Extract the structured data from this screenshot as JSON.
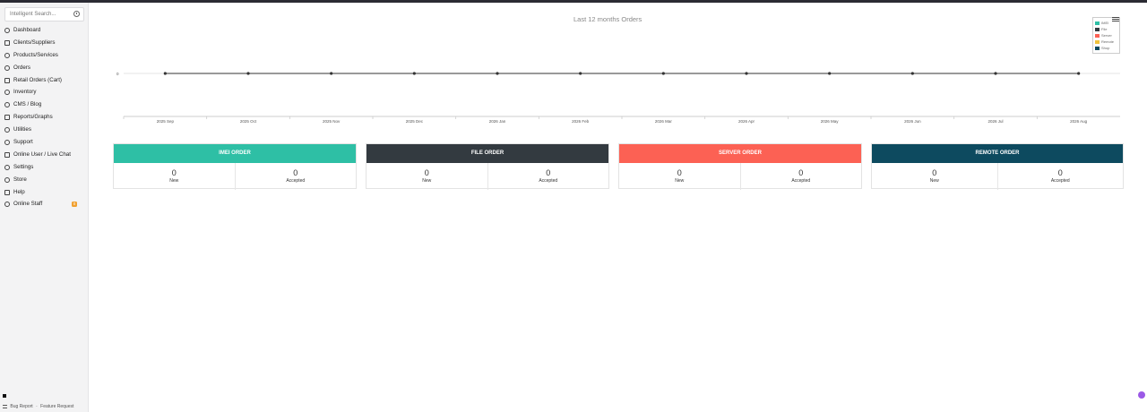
{
  "sidebar": {
    "search_placeholder": "Intelligent Search...",
    "items": [
      {
        "label": "Dashboard",
        "icon": "dashboard-icon"
      },
      {
        "label": "Clients/Suppliers",
        "icon": "users-icon"
      },
      {
        "label": "Products/Services",
        "icon": "tools-icon"
      },
      {
        "label": "Orders",
        "icon": "orders-icon"
      },
      {
        "label": "Retail Orders (Cart)",
        "icon": "cart-icon"
      },
      {
        "label": "Inventory",
        "icon": "inventory-icon"
      },
      {
        "label": "CMS / Blog",
        "icon": "blog-icon"
      },
      {
        "label": "Reports/Graphs",
        "icon": "reports-icon"
      },
      {
        "label": "Utilities",
        "icon": "utilities-icon"
      },
      {
        "label": "Support",
        "icon": "support-icon"
      },
      {
        "label": "Online User / Live Chat",
        "icon": "chat-icon"
      },
      {
        "label": "Settings",
        "icon": "settings-icon"
      },
      {
        "label": "Store",
        "icon": "store-icon"
      },
      {
        "label": "Help",
        "icon": "help-icon"
      },
      {
        "label": "Online Staff",
        "icon": "staff-icon",
        "badge": "0"
      }
    ],
    "bottom": {
      "bug_report": "Bug Report",
      "separator": "·",
      "feature_request": "Feature Request"
    }
  },
  "chart_data": {
    "type": "line",
    "title": "Last 12 months Orders",
    "categories": [
      "2025 Sep",
      "2025 Oct",
      "2025 Nov",
      "2025 Dec",
      "2026 Jan",
      "2026 Feb",
      "2026 Mar",
      "2026 Apr",
      "2026 May",
      "2026 Jun",
      "2026 Jul",
      "2026 Aug"
    ],
    "series": [
      {
        "name": "IMEI",
        "color": "#2ebfa5",
        "values": [
          0,
          0,
          0,
          0,
          0,
          0,
          0,
          0,
          0,
          0,
          0,
          0
        ]
      },
      {
        "name": "File",
        "color": "#333a40",
        "values": [
          0,
          0,
          0,
          0,
          0,
          0,
          0,
          0,
          0,
          0,
          0,
          0
        ]
      },
      {
        "name": "Server",
        "color": "#fc6154",
        "values": [
          0,
          0,
          0,
          0,
          0,
          0,
          0,
          0,
          0,
          0,
          0,
          0
        ]
      },
      {
        "name": "Remote",
        "color": "#f0c33c",
        "values": [
          0,
          0,
          0,
          0,
          0,
          0,
          0,
          0,
          0,
          0,
          0,
          0
        ]
      },
      {
        "name": "Shop",
        "color": "#0d4a5f",
        "values": [
          0,
          0,
          0,
          0,
          0,
          0,
          0,
          0,
          0,
          0,
          0,
          0
        ]
      }
    ],
    "y_tick_labels": [
      "0"
    ],
    "grid": true,
    "legend_position": "top-right"
  },
  "cards": [
    {
      "title": "IMEI ORDER",
      "color": "#2ebfa5",
      "new_value": "0",
      "new_label": "New",
      "accepted_value": "0",
      "accepted_label": "Accepted"
    },
    {
      "title": "FILE ORDER",
      "color": "#333a40",
      "new_value": "0",
      "new_label": "New",
      "accepted_value": "0",
      "accepted_label": "Accepted"
    },
    {
      "title": "SERVER ORDER",
      "color": "#fc6154",
      "new_value": "0",
      "new_label": "New",
      "accepted_value": "0",
      "accepted_label": "Accepted"
    },
    {
      "title": "REMOTE ORDER",
      "color": "#0d4a5f",
      "new_value": "0",
      "new_label": "New",
      "accepted_value": "0",
      "accepted_label": "Accepted"
    }
  ]
}
